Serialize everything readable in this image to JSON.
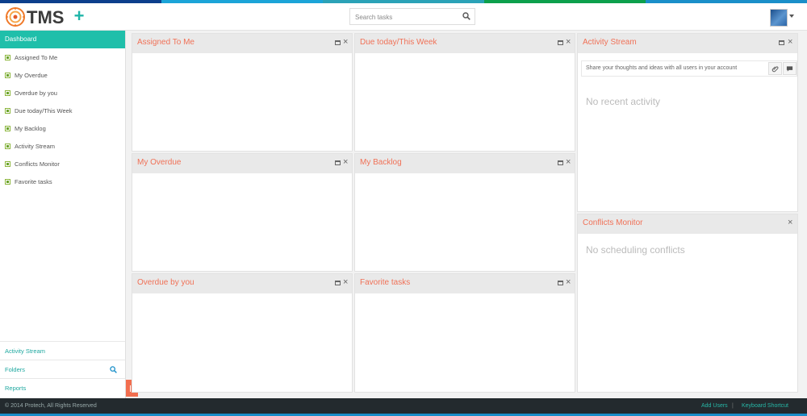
{
  "stripe_colors": [
    "#0c3f8c",
    "#1ba4d8",
    "#2ba2b7",
    "#0da04c",
    "#1a8fc9"
  ],
  "header": {
    "logo_text": "TMS",
    "add_label": "+",
    "search_placeholder": "Search tasks"
  },
  "sidebar": {
    "dashboard": "Dashboard",
    "items": [
      {
        "label": "Assigned To Me"
      },
      {
        "label": "My Overdue"
      },
      {
        "label": "Overdue by you"
      },
      {
        "label": "Due today/This Week"
      },
      {
        "label": "My Backlog"
      },
      {
        "label": "Activity Stream"
      },
      {
        "label": "Conflicts Monitor"
      },
      {
        "label": "Favorite tasks"
      }
    ],
    "bottom": {
      "activity_stream": "Activity Stream",
      "folders": "Folders",
      "reports": "Reports"
    }
  },
  "panels": {
    "assigned": "Assigned To Me",
    "due_week": "Due today/This Week",
    "overdue": "My Overdue",
    "backlog": "My Backlog",
    "overdue_by_you": "Overdue by you",
    "favorite": "Favorite tasks",
    "activity": {
      "title": "Activity Stream",
      "share_placeholder": "Share your thoughts and ideas with all users in your account",
      "empty": "No recent activity"
    },
    "conflicts": {
      "title": "Conflicts Monitor",
      "empty": "No scheduling conflicts"
    },
    "close_glyph": "×"
  },
  "footer": {
    "copyright": "© 2014 Protech, All Rights Reserved",
    "add_users": "Add Users",
    "separator": "|",
    "keyboard_shortcut": "Keyboard Shortcut"
  }
}
